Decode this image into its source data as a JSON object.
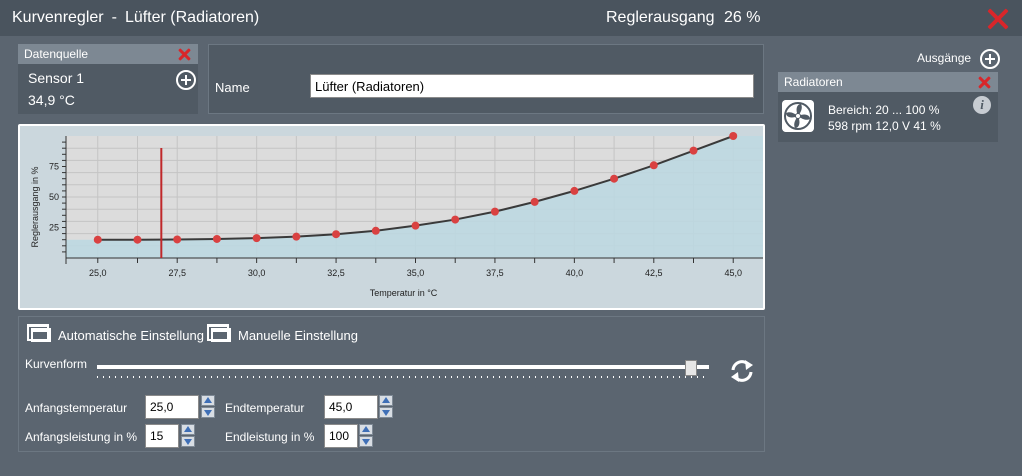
{
  "titlebar": {
    "title": "Kurvenregler",
    "separator": "-",
    "name": "Lüfter (Radiatoren)",
    "output_label": "Reglerausgang",
    "output_value": "26 %"
  },
  "datasource": {
    "header": "Datenquelle",
    "sensor": "Sensor 1",
    "value": "34,9 °C"
  },
  "name_field": {
    "label": "Name",
    "value": "Lüfter (Radiatoren)"
  },
  "chart_data": {
    "type": "line",
    "xlabel": "Temperatur in °C",
    "ylabel": "Reglerausgang in %",
    "xlim": [
      24.0,
      46.0
    ],
    "ylim": [
      0,
      100
    ],
    "x_ticks": [
      "25,0",
      "26,3",
      "27,5",
      "28,8",
      "30,0",
      "31,3",
      "32,5",
      "33,8",
      "35,0",
      "36,3",
      "37,5",
      "38,8",
      "40,0",
      "41,3",
      "42,5",
      "43,8",
      "45,0"
    ],
    "x_tick_values": [
      25.0,
      26.25,
      27.5,
      28.75,
      30.0,
      31.25,
      32.5,
      33.75,
      35.0,
      36.25,
      37.5,
      38.75,
      40.0,
      41.25,
      42.5,
      43.75,
      45.0
    ],
    "x_tick_labels_shown": [
      "25,0",
      "27,5",
      "30,0",
      "32,5",
      "35,0",
      "37,5",
      "40,0",
      "42,5",
      "45,0"
    ],
    "x_tick_label_values": [
      25.0,
      27.5,
      30.0,
      32.5,
      35.0,
      37.5,
      40.0,
      42.5,
      45.0
    ],
    "y_tick_labels": [
      "25",
      "50",
      "75"
    ],
    "y_tick_label_values": [
      25,
      50,
      75
    ],
    "series": [
      {
        "x": [
          25.0,
          26.25,
          27.5,
          28.75,
          30.0,
          31.25,
          32.5,
          33.75,
          35.0,
          36.25,
          37.5,
          38.75,
          40.0,
          41.25,
          42.5,
          43.75,
          45.0
        ],
        "y": [
          15,
          15,
          15.2,
          15.6,
          16.3,
          17.5,
          19.5,
          22.3,
          26.5,
          31.5,
          38,
          46,
          55,
          65,
          76,
          88,
          100
        ]
      }
    ],
    "marker_x": 27.0,
    "grid": true
  },
  "controls": {
    "auto_label": "Automatische Einstellung",
    "manual_label": "Manuelle Einstellung",
    "curve_label": "Kurvenform",
    "curve_value_fraction": 0.97,
    "start_temp_label": "Anfangstemperatur",
    "start_temp_value": "25,0",
    "end_temp_label": "Endtemperatur",
    "end_temp_value": "45,0",
    "start_power_label": "Anfangsleistung in %",
    "start_power_value": "15",
    "end_power_label": "Endleistung in %",
    "end_power_value": "100"
  },
  "outputs": {
    "label": "Ausgänge",
    "item": {
      "header": "Radiatoren",
      "range": "Bereich:  20 ... 100  %",
      "stats": "598 rpm  12,0 V  41 %"
    }
  },
  "colors": {
    "accent_red": "#d9262a",
    "point_red": "#d94141",
    "curve": "#3a3a3a",
    "fill": "#bcd8e1"
  }
}
